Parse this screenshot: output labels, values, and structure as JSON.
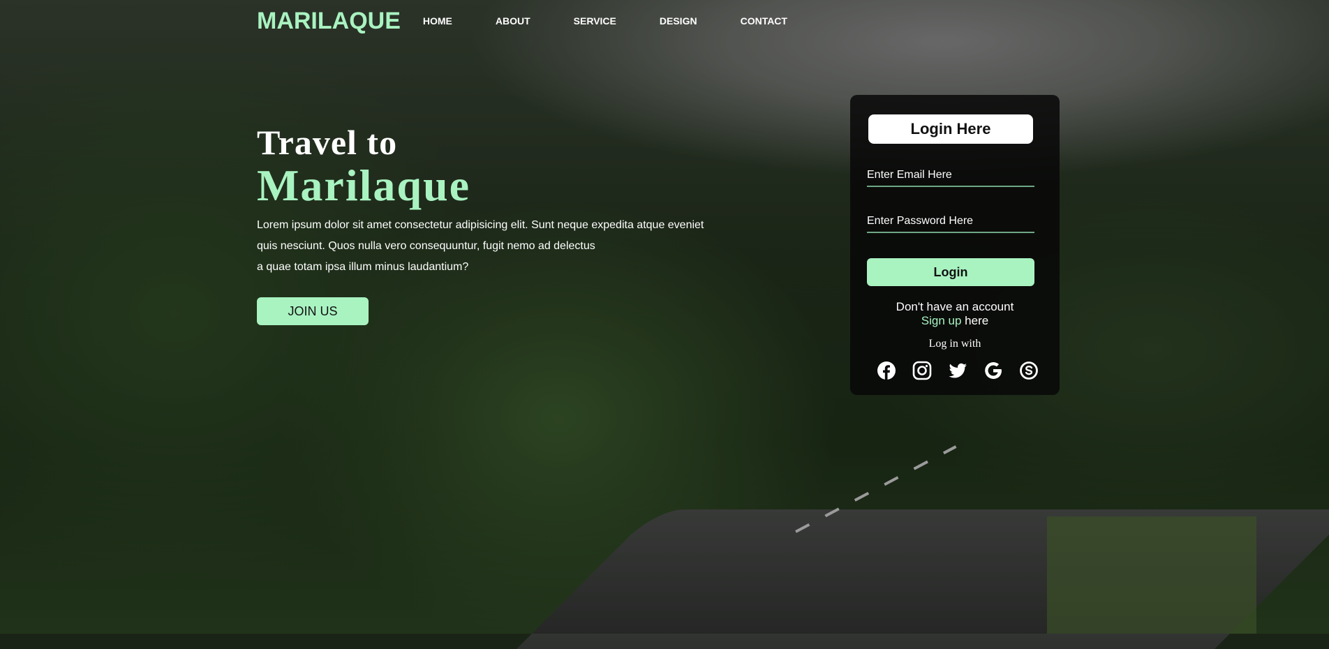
{
  "nav": {
    "logo": "MARILAQUE",
    "items": [
      "HOME",
      "ABOUT",
      "SERVICE",
      "DESIGN",
      "CONTACT"
    ]
  },
  "hero": {
    "heading": "Travel to",
    "brand": "Marilaque",
    "lines": [
      "Lorem ipsum dolor sit amet consectetur adipisicing elit. Sunt neque expedita atque eveniet",
      "quis nesciunt. Quos nulla vero consequuntur, fugit nemo ad delectus",
      "a quae totam ipsa illum minus laudantium?"
    ],
    "join_label": "JOIN US"
  },
  "login": {
    "title": "Login Here",
    "email_placeholder": "Enter Email Here",
    "password_placeholder": "Enter Password Here",
    "button_label": "Login",
    "no_account": "Don't have an account",
    "signup_link": "Sign up",
    "signup_suffix": " here",
    "log_in_with": "Log in with",
    "social_icons": [
      "facebook-icon",
      "instagram-icon",
      "twitter-icon",
      "google-icon",
      "skype-icon"
    ]
  },
  "colors": {
    "accent": "#a9f3c1",
    "card_bg": "#080808",
    "text": "#ffffff"
  }
}
